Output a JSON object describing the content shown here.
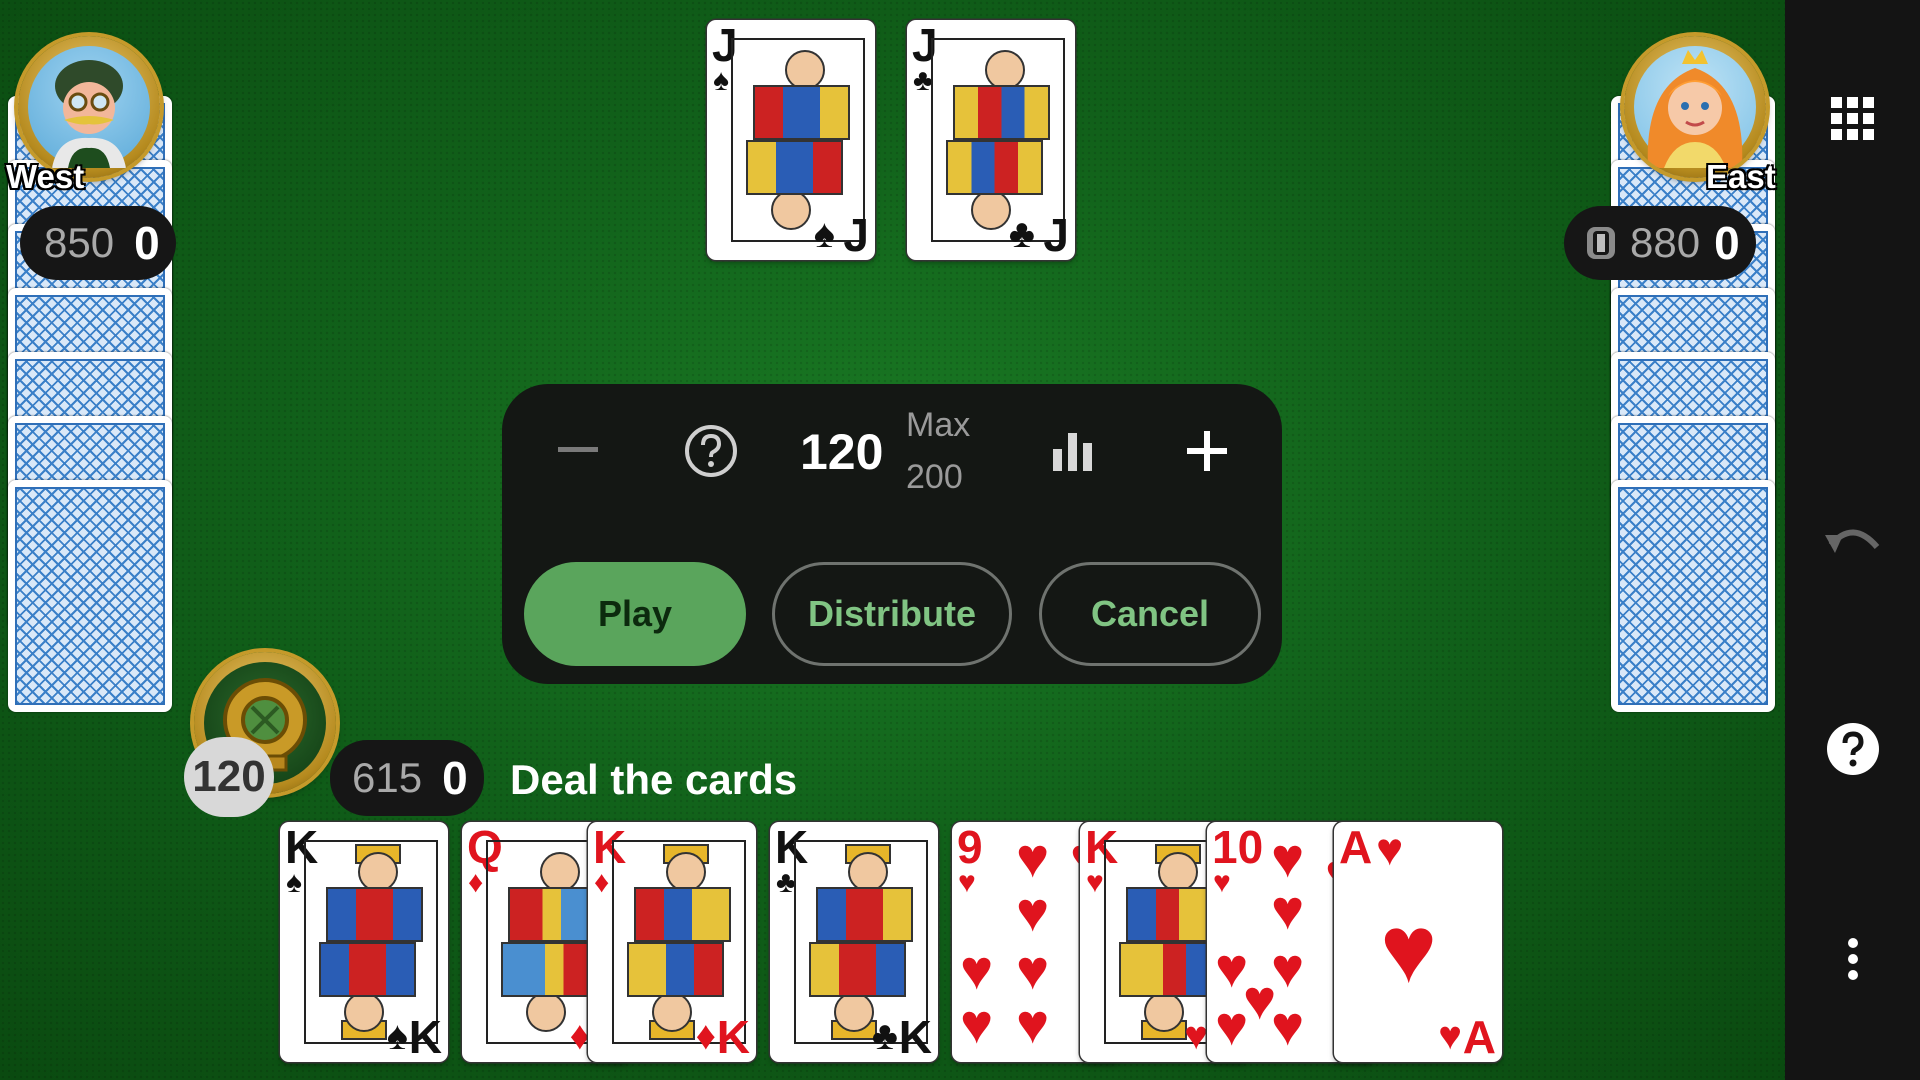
{
  "players": {
    "west": {
      "name": "West",
      "points": "850",
      "tricks": "0"
    },
    "east": {
      "name": "East",
      "points": "880",
      "tricks": "0"
    },
    "south": {
      "points": "615",
      "tricks": "0",
      "bid_badge": "120"
    }
  },
  "trick_cards": [
    {
      "rank": "J",
      "suit": "♠",
      "color": "black"
    },
    {
      "rank": "J",
      "suit": "♣",
      "color": "black"
    }
  ],
  "bid_panel": {
    "minus_icon": "minus-icon",
    "help_icon": "question-circle-icon",
    "current_bid": "120",
    "max_label": "Max",
    "max_value": "200",
    "stats_icon": "bar-chart-icon",
    "plus_icon": "plus-icon",
    "buttons": {
      "play": "Play",
      "distribute": "Distribute",
      "cancel": "Cancel"
    }
  },
  "status": {
    "message": "Deal the cards"
  },
  "hand": [
    {
      "rank": "K",
      "suit": "♠",
      "color": "black"
    },
    {
      "rank": "Q",
      "suit": "♦",
      "color": "red"
    },
    {
      "rank": "K",
      "suit": "♦",
      "color": "red"
    },
    {
      "rank": "K",
      "suit": "♣",
      "color": "black"
    },
    {
      "rank": "9",
      "suit": "♥",
      "color": "red"
    },
    {
      "rank": "K",
      "suit": "♥",
      "color": "red"
    },
    {
      "rank": "10",
      "suit": "♥",
      "color": "red"
    },
    {
      "rank": "A",
      "suit": "♥",
      "color": "red"
    }
  ],
  "sidebar": {
    "grid_icon": "grid-menu-icon",
    "undo_icon": "undo-icon",
    "help_icon": "help-icon",
    "more_icon": "more-vertical-icon"
  },
  "colors": {
    "table": "#11611a",
    "panel": "#141714",
    "play_button": "#5aa55c",
    "outline_text": "#80c483"
  }
}
